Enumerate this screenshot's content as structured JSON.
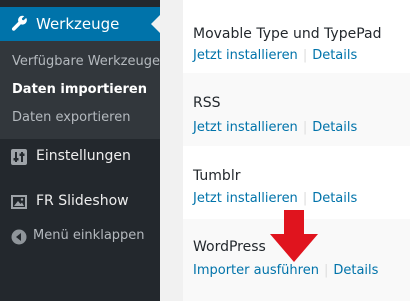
{
  "sidebar": {
    "active_menu": {
      "label": "Werkzeuge",
      "icon": "wrench-icon"
    },
    "submenu": [
      {
        "label": "Verfügbare Werkzeuge",
        "current": false
      },
      {
        "label": "Daten importieren",
        "current": true
      },
      {
        "label": "Daten exportieren",
        "current": false
      }
    ],
    "items": [
      {
        "label": "Einstellungen",
        "icon": "settings-sliders-icon"
      },
      {
        "label": "FR Slideshow",
        "icon": "slideshow-image-icon"
      }
    ],
    "collapse_label": "Menü einklappen",
    "colors": {
      "background": "#23282d",
      "accent": "#0073aa",
      "submenu_bg": "#32373c"
    }
  },
  "importers": [
    {
      "title": "Movable Type und TypePad",
      "action_label": "Jetzt installieren",
      "details_label": "Details"
    },
    {
      "title": "RSS",
      "action_label": "Jetzt installieren",
      "details_label": "Details"
    },
    {
      "title": "Tumblr",
      "action_label": "Jetzt installieren",
      "details_label": "Details"
    },
    {
      "title": "WordPress",
      "action_label": "Importer ausführen",
      "details_label": "Details"
    }
  ],
  "annotation": {
    "icon": "red-down-arrow-icon",
    "color": "#e0141e"
  }
}
